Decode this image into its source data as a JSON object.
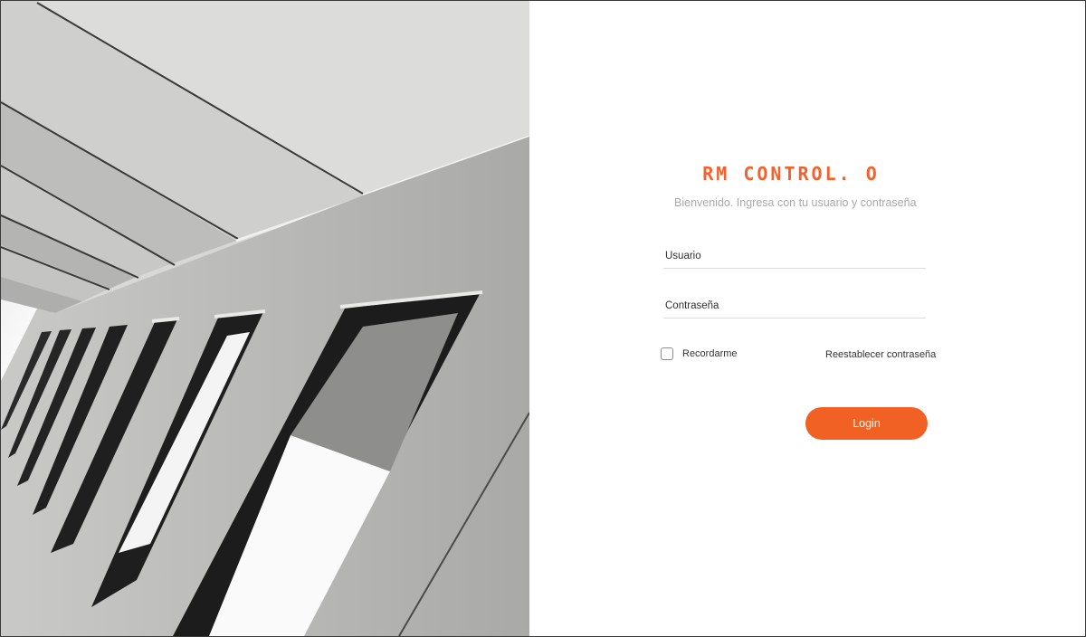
{
  "brand": {
    "title": "RM CONTROL. O",
    "subtitle": "Bienvenido. Ingresa con tu usuario y contraseña",
    "accent_color": "#f26124"
  },
  "form": {
    "username_placeholder": "Usuario",
    "password_placeholder": "Contraseña",
    "remember_label": "Recordarme",
    "reset_password_label": "Reestablecer contraseña",
    "login_label": "Login"
  },
  "hero": {
    "icon": "building-facade-photo"
  }
}
